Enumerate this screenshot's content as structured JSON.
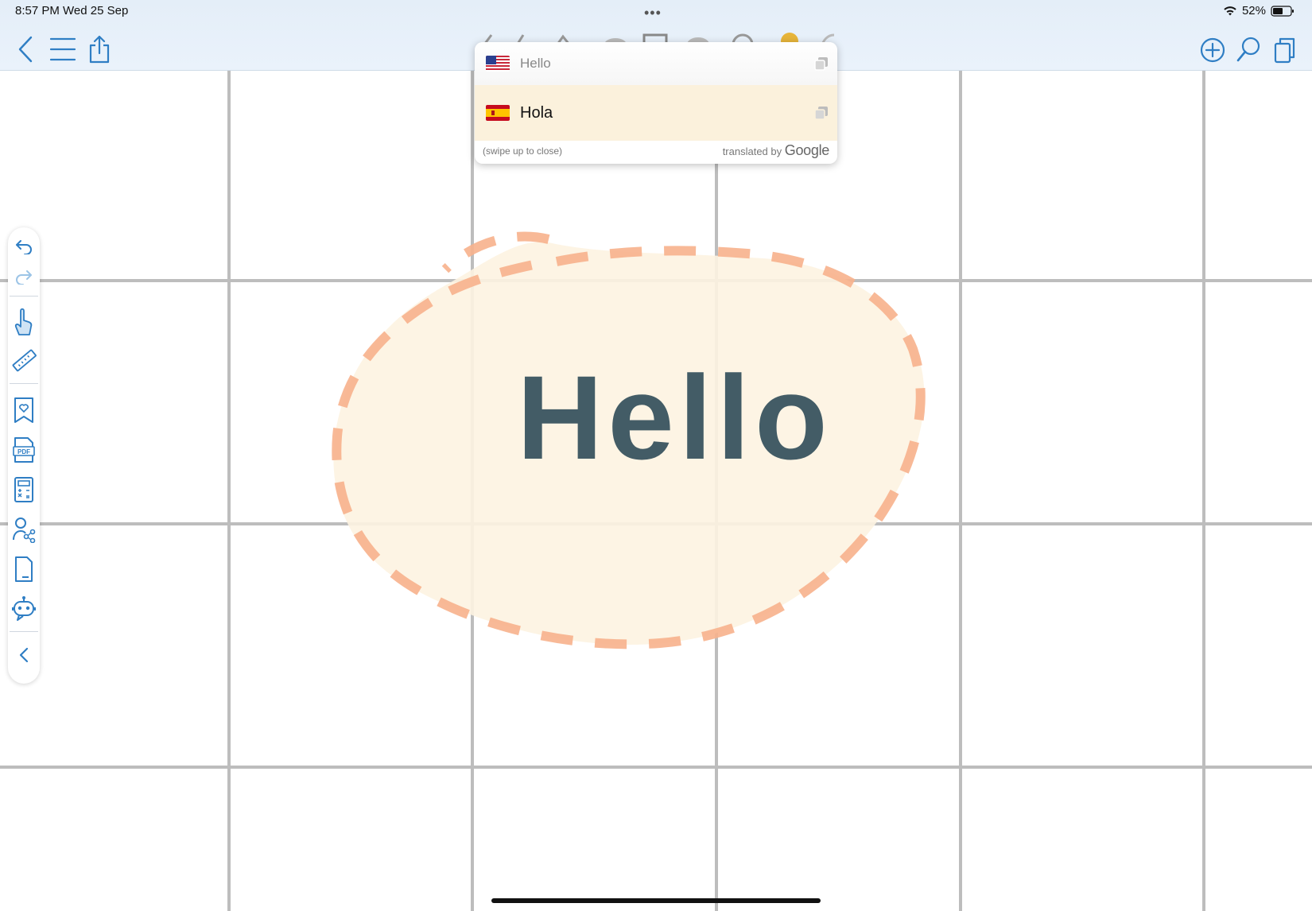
{
  "status": {
    "time_date": "8:57 PM   Wed 25 Sep",
    "battery": "52%"
  },
  "toolbar": {
    "back": "back-icon",
    "menu": "menu-icon",
    "share": "share-icon",
    "add": "add-icon",
    "search": "search-icon",
    "pages": "pages-icon"
  },
  "translation": {
    "source_text": "Hello",
    "target_text": "Hola",
    "hint": "(swipe up to close)",
    "credit_prefix": "translated by",
    "credit_brand": "Google"
  },
  "canvas": {
    "handwriting": "Hello",
    "grid_color": "#bdbdbd",
    "blob_fill": "#fdf3e1",
    "blob_stroke": "#f7b18c",
    "ink_color": "#435c66"
  },
  "sidebar": [
    "undo-icon",
    "redo-icon",
    "hand-icon",
    "ruler-icon",
    "bookmark-icon",
    "pdf-icon",
    "calculator-icon",
    "collaborate-icon",
    "page-icon",
    "assistant-icon",
    "collapse-icon"
  ]
}
